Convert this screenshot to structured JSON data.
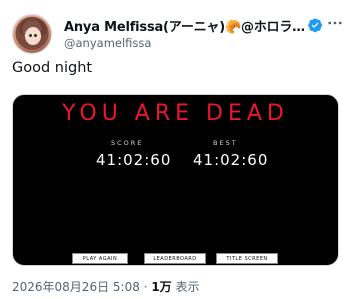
{
  "tweet": {
    "display_name": "Anya Melfissa(アーニャ)🥐@ホロラ…",
    "handle": "@anyamelfissa",
    "text": "Good night",
    "timestamp": "2026年08月26日 5:08",
    "separator": "·",
    "views_count": "1万",
    "views_label": "表示"
  },
  "game": {
    "title": "YOU ARE DEAD",
    "score_label": "SCORE",
    "score_value": "41:02:60",
    "best_label": "BEST",
    "best_value": "41:02:60",
    "buttons": {
      "play_again": "PLAY AGAIN",
      "leaderboard": "LEADERBOARD",
      "title_screen": "TITLE SCREEN"
    }
  },
  "colors": {
    "accent_red": "#e8192c",
    "verified_blue": "#1d9bf0",
    "secondary_text": "#536471"
  },
  "icons": {
    "verified": "verified-badge-icon",
    "more": "more-options-icon"
  }
}
